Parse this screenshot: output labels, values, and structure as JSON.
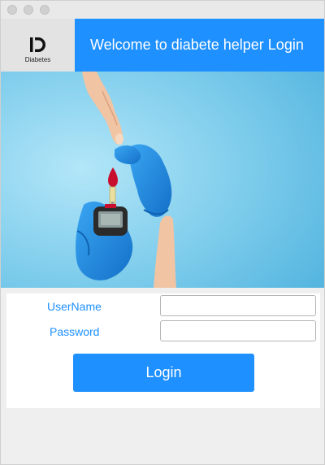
{
  "window": {
    "controls": [
      "close",
      "minimize",
      "zoom"
    ]
  },
  "header": {
    "logo_text": "Diabetes",
    "title": "Welcome to diabete helper Login"
  },
  "hero": {
    "image": "glucose-meter-finger-prick-photo",
    "background_color": "#7fcdec",
    "blood_color": "#c8102e",
    "glove_color": "#1f8fe6"
  },
  "form": {
    "username_label": "UserName",
    "username_value": "",
    "password_label": "Password",
    "password_value": "",
    "login_label": "Login"
  },
  "colors": {
    "accent": "#1e90ff",
    "logo_bg": "#e3e3e3",
    "window_bg": "#efefef"
  }
}
